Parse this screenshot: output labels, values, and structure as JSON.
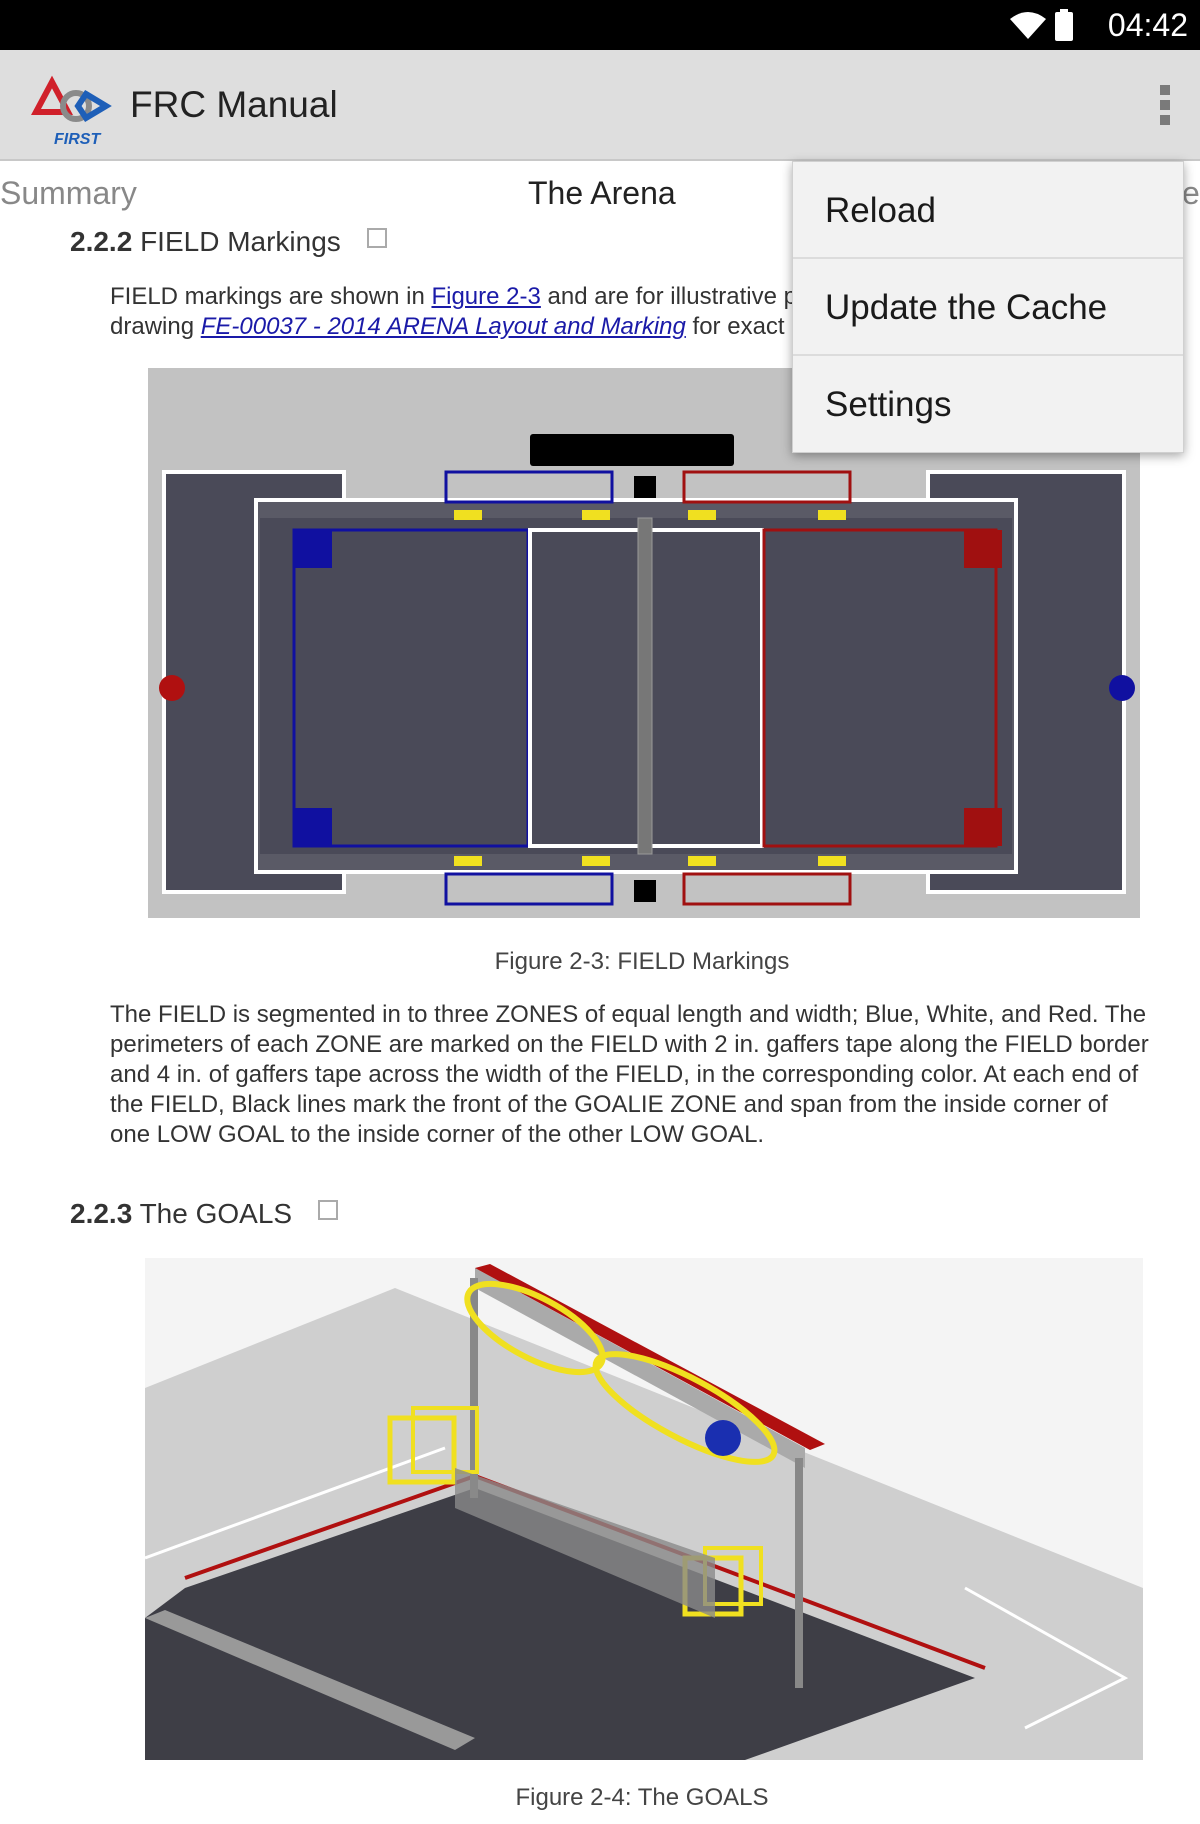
{
  "status_bar": {
    "time": "04:42"
  },
  "app_bar": {
    "title": "FRC Manual",
    "logo_text": "FIRST"
  },
  "tabs": {
    "left": "Summary",
    "current": "The Arena",
    "right": "e"
  },
  "section_222": {
    "number": "2.2.2",
    "title": "FIELD Markings",
    "para_prefix": "FIELD markings are shown in ",
    "figure_link": "Figure 2-3",
    "para_mid": " and are for illustrative p",
    "para_line2_prefix": "drawing ",
    "drawing_link": "FE-00037 - 2014 ARENA Layout and Marking",
    "para_line2_suffix": " for exact dim",
    "caption": "Figure 2-3: FIELD Markings",
    "body": "The FIELD is segmented in to three ZONES of equal length and width; Blue, White, and Red. The perimeters of each ZONE are marked on the FIELD with 2 in. gaffers tape along the FIELD border and 4 in. of gaffers tape across the width of the FIELD, in the corresponding color. At each end of the FIELD, Black lines mark the front of the GOALIE ZONE and span from the inside corner of one LOW GOAL to the inside corner of the other LOW GOAL."
  },
  "section_223": {
    "number": "2.2.3",
    "title": "The GOALS",
    "caption": "Figure 2-4: The GOALS"
  },
  "menu": {
    "items": [
      "Reload",
      "Update the Cache",
      "Settings"
    ]
  },
  "colors": {
    "blue_zone": "#1010a0",
    "red_zone": "#a01010",
    "goal_yellow": "#f0e020",
    "field_carpet": "#4a4a58",
    "action_bar": "#dedede"
  }
}
